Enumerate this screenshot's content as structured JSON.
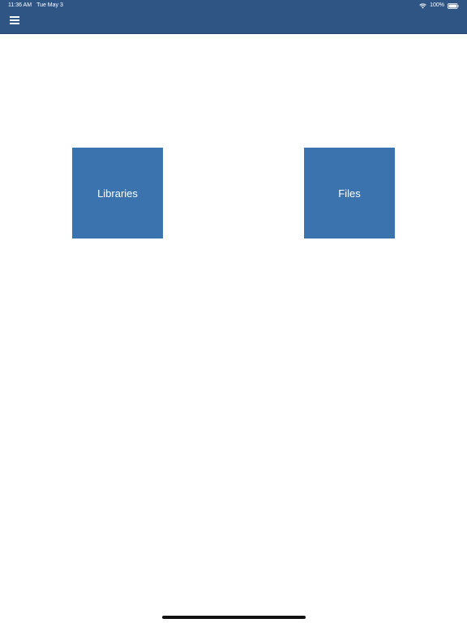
{
  "status_bar": {
    "time": "11:36 AM",
    "date": "Tue May 3",
    "battery": "100%",
    "wifi_icon": "wifi-icon",
    "battery_icon": "battery-icon"
  },
  "header": {
    "menu_icon": "hamburger-menu-icon",
    "background_color": "#2f5585"
  },
  "tiles": [
    {
      "label": "Libraries"
    },
    {
      "label": "Files"
    }
  ],
  "colors": {
    "tile_background": "#3a73ad",
    "tile_text": "#ffffff"
  }
}
